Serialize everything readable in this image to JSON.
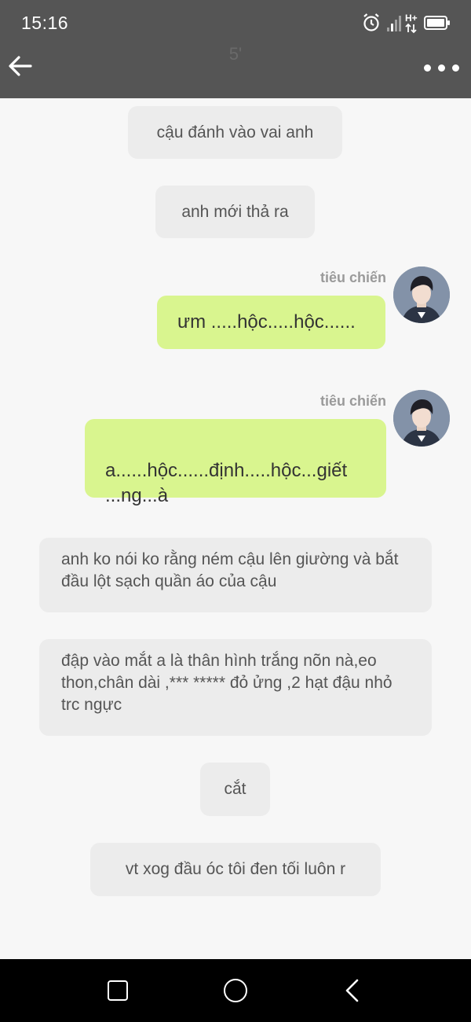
{
  "status_bar": {
    "time": "15:16",
    "icons": [
      "alarm-icon",
      "signal-icon",
      "h-plus-icon",
      "battery-icon"
    ],
    "network_label": "H+"
  },
  "header": {
    "title": "5'",
    "back_icon": "back-arrow-icon",
    "menu_icon": "more-icon"
  },
  "messages": [
    {
      "type": "system",
      "text": "cậu đánh vào vai anh"
    },
    {
      "type": "system",
      "text": "anh mới thả ra"
    },
    {
      "type": "outgoing",
      "sender": "tiêu chiến",
      "text": "ưm .....hộc.....hộc......"
    },
    {
      "type": "outgoing",
      "sender": "tiêu chiến",
      "text": "a......hộc......định.....hộc...giết\n...ng...à"
    },
    {
      "type": "system",
      "text": "anh ko nói ko rằng ném cậu lên giường và bắt đầu lột sạch quần áo của cậu"
    },
    {
      "type": "system",
      "text": "đập vào mắt a là thân hình trắng nõn nà,eo thon,chân dài ,*** ***** đỏ ửng ,2 hạt đậu nhỏ trc ngực"
    },
    {
      "type": "system",
      "text": "cắt"
    },
    {
      "type": "system",
      "text": "vt xog đầu óc tôi đen tối luôn r"
    }
  ],
  "nav_bar": {
    "icons": [
      "recent-apps-icon",
      "home-icon",
      "back-icon"
    ]
  },
  "colors": {
    "header_bg": "#555555",
    "chat_bg": "#f7f7f7",
    "system_bubble": "#ececec",
    "outgoing_bubble": "#d9f58f",
    "nav_bg": "#000000"
  }
}
